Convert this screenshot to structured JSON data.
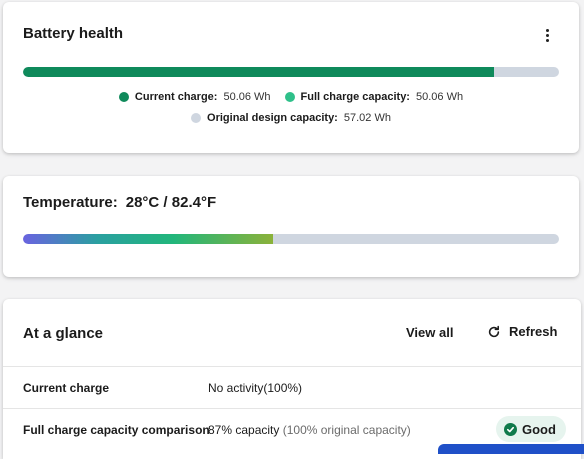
{
  "battery": {
    "title": "Battery health",
    "bar_fraction": 0.878,
    "legend": {
      "current": {
        "label": "Current charge:",
        "value": "50.06 Wh",
        "color": "#0f8a5b"
      },
      "full": {
        "label": "Full charge capacity:",
        "value": "50.06 Wh",
        "color": "#2fc08a"
      },
      "design": {
        "label": "Original design capacity:",
        "value": "57.02 Wh",
        "color": "#cfd6e0"
      }
    },
    "menu_icon": "more-vertical-icon"
  },
  "temperature": {
    "label": "Temperature:",
    "value": "28°C / 82.4°F",
    "bar_fraction": 0.467
  },
  "glance": {
    "title": "At a glance",
    "view_all": "View all",
    "refresh": "Refresh",
    "rows": [
      {
        "label": "Current charge",
        "value": "No activity(100%)",
        "sub": ""
      },
      {
        "label": "Full charge capacity comparison",
        "value": "87% capacity",
        "sub": "(100% original capacity)"
      }
    ],
    "status_badge": "Good",
    "status_color": "#0f7a4b"
  }
}
